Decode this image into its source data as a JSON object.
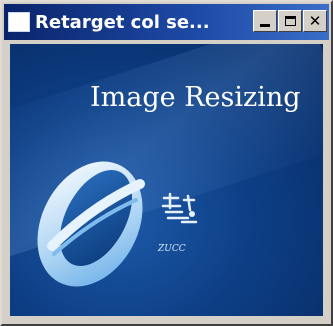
{
  "window": {
    "title": "Retarget col se...",
    "controls": {
      "minimize_icon": "minimize-icon",
      "maximize_icon": "maximize-icon",
      "close_label": "✕"
    }
  },
  "content": {
    "heading": "Image Resizing",
    "logo_text": "ZUCC"
  },
  "colors": {
    "titlebar": "#0a246a",
    "background": "#0d3f86",
    "accent": "#cfe4f8"
  }
}
